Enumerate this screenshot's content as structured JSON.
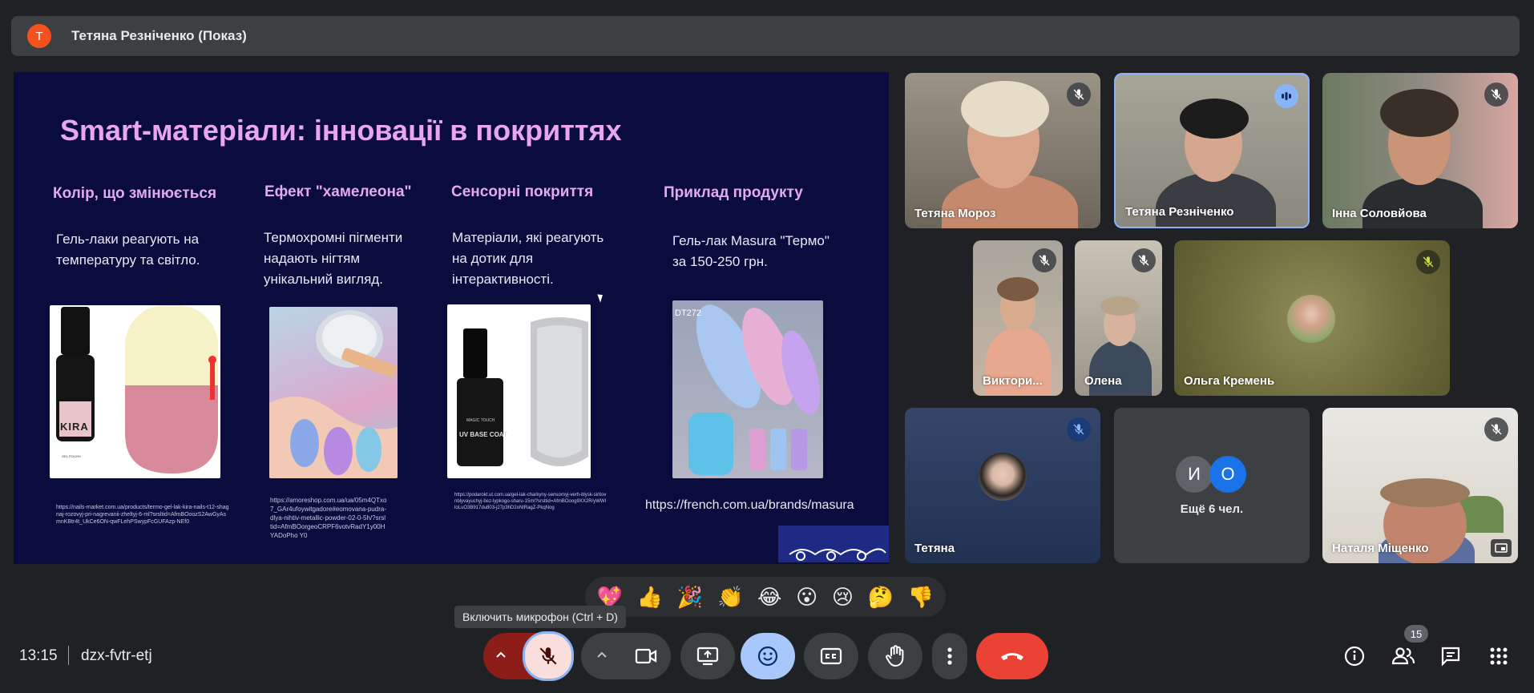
{
  "topbar": {
    "avatar_letter": "T",
    "presenter": "Тетяна Резніченко (Показ)"
  },
  "slide": {
    "title": "Smart-матеріали: інновації в покриттях",
    "columns": [
      {
        "head": "Колір, що змінюється",
        "desc": "Гель-лаки реагують на температуру та світло.",
        "url": "https://nails-market.com.ua/products/termo-gel-lak-kira-nails-t12-shagnaj-rozovyj-pri-nagrevanii-zheltyj-6-ml?srsltid=AfmBOoozS2AwGyAsmnKBtr4t_UkCe6ON-qwFLehPSwypFcGUFAzp-NEf0"
      },
      {
        "head": "Ефект \"хамелеона\"",
        "desc": "Термохромні пігменти надають нігтям унікальний вигляд.",
        "url": "https://amoreshop.com.ua/ua/05m4QTxo7_GAr4ufoywitgadore#eomovana-pudra-dlya-nihtiv-metallic-powder-02-0-5h/?srsltid=AfmBOorgeoCRPF6votvRadY1y00HYADoPho Y0"
      },
      {
        "head": "Сенсорні покриття",
        "desc": "Матеріали, які реагують на дотик для інтерактивності.",
        "url": "https://podarokt.ut.com.ua/gel-lak-charkyny-sensornyj-verh-blysk-siritovnblyvayuchyj-bez-lypkogo-sharu-15ml?srsltid=AfmBOoog9XX2R/yWWIloLuO3B917du803-j27p3hD2oNlRagZ-PkqNog"
      },
      {
        "head": "Приклад продукту",
        "desc": "Гель-лак Masura \"Термо\" за 150-250 грн.",
        "url": "https://french.com.ua/brands/masura"
      }
    ],
    "product_labels": {
      "kira_brand": "KIRA",
      "kira_sub": "GEL POLISH",
      "coat_l1": "MAGIC TOUCH",
      "coat_l2": "UV BASE COAT",
      "masura_code": "DT272"
    }
  },
  "participants": [
    {
      "name": "Тетяна Мороз",
      "muted": true
    },
    {
      "name": "Тетяна Резніченко",
      "speaking": true
    },
    {
      "name": "Інна Соловйова",
      "muted": true
    },
    {
      "name": "Виктори...",
      "muted": true
    },
    {
      "name": "Олена",
      "muted": true
    },
    {
      "name": "Ольга Кремень",
      "muted": true
    },
    {
      "name": "Тетяна",
      "muted": true
    },
    {
      "name": "Наталя Міщенко",
      "muted": true
    }
  ],
  "others": {
    "initial1": "И",
    "initial2": "О",
    "label": "Ещё 6 чел.",
    "color1": "#5f6368",
    "color2": "#1a73e8"
  },
  "reactions": [
    "💖",
    "👍",
    "🎉",
    "👏",
    "😂",
    "😮",
    "😢",
    "🤔",
    "👎"
  ],
  "tooltip": "Включить микрофон (Ctrl + D)",
  "bottom": {
    "time": "13:15",
    "code": "dzx-fvtr-etj",
    "people_count": "15"
  },
  "colors": {
    "end_call": "#ea4335",
    "mic_off": "#f9dedc",
    "emoji_active": "#a8c7fa",
    "speaking": "#8ab4f8",
    "mic_arrow_bg": "#8c1d18"
  }
}
